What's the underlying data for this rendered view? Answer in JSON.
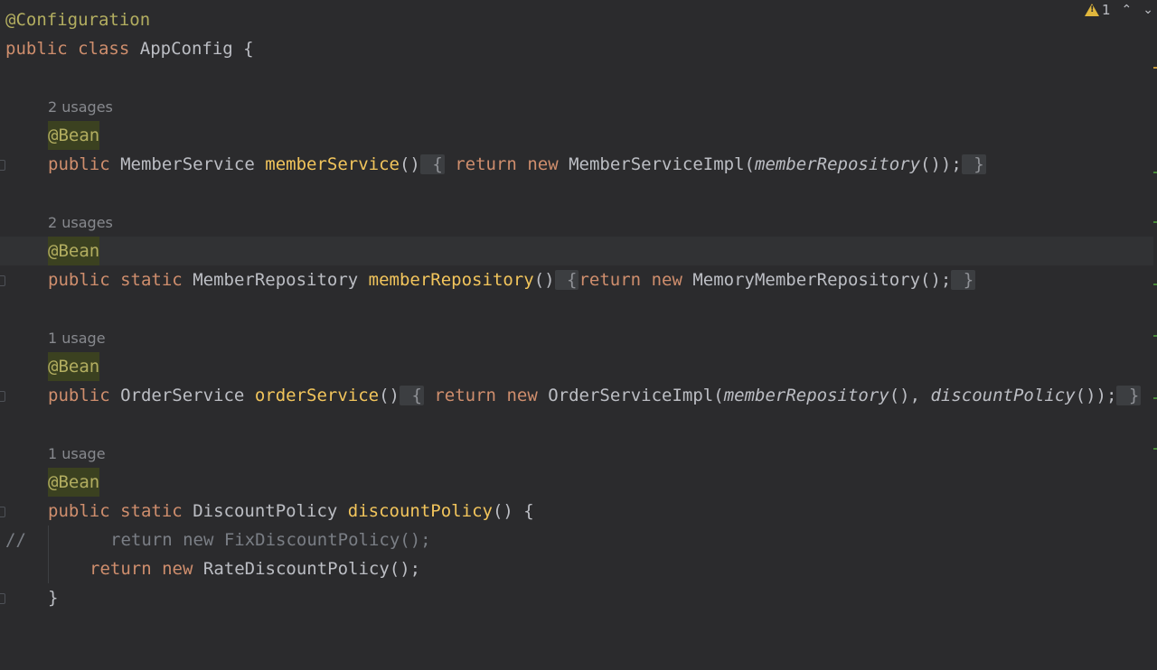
{
  "editor": {
    "lines": {
      "l1": {
        "annotation": "@Configuration"
      },
      "l2": {
        "kw_public": "public",
        "kw_class": "class",
        "name": "AppConfig",
        "brace": " {"
      },
      "ms": {
        "usages": "2 usages",
        "annotation": "@Bean",
        "kw_public": "public",
        "type": "MemberService",
        "method": "memberService",
        "parens": "()",
        "open": " {",
        "kw_return": "return",
        "kw_new": "new",
        "ctor": "MemberServiceImpl(",
        "call": "memberRepository",
        "tail": "());",
        "close": " }"
      },
      "mr": {
        "usages": "2 usages",
        "annotation": "@Bean",
        "kw_public": "public",
        "kw_static": "static",
        "type": "MemberRepository",
        "method": "memberRepository",
        "parens": "()",
        "open": " {",
        "kw_return": "return",
        "kw_new": "new",
        "ctor": "MemoryMemberRepository();",
        "close": " }"
      },
      "os": {
        "usages": "1 usage",
        "annotation": "@Bean",
        "kw_public": "public",
        "type": "OrderService",
        "method": "orderService",
        "parens": "()",
        "open": " {",
        "kw_return": "return",
        "kw_new": "new",
        "ctor": "OrderServiceImpl(",
        "call1": "memberRepository",
        "mid": "(), ",
        "call2": "discountPolicy",
        "tail": "());",
        "close": " }"
      },
      "dp": {
        "usages": "1 usage",
        "annotation": "@Bean",
        "kw_public": "public",
        "kw_static": "static",
        "type": "DiscountPolicy",
        "method": "discountPolicy",
        "parens": "() {",
        "comment_prefix": "//",
        "commented": "return new FixDiscountPolicy();",
        "kw_return": "return",
        "kw_new": "new",
        "ctor": "RateDiscountPolicy();",
        "close": "}"
      }
    },
    "toolbar": {
      "warning_count": "1",
      "warning_icon": "warning-triangle-icon",
      "up_icon": "chevron-up-icon",
      "down_icon": "chevron-down-icon"
    }
  },
  "colors": {
    "background": "#2b2b2d",
    "keyword": "#cf8e6d",
    "annotation": "#b3ae60",
    "method_decl": "#f2c55c",
    "text": "#bcbec4",
    "muted": "#87898e"
  }
}
